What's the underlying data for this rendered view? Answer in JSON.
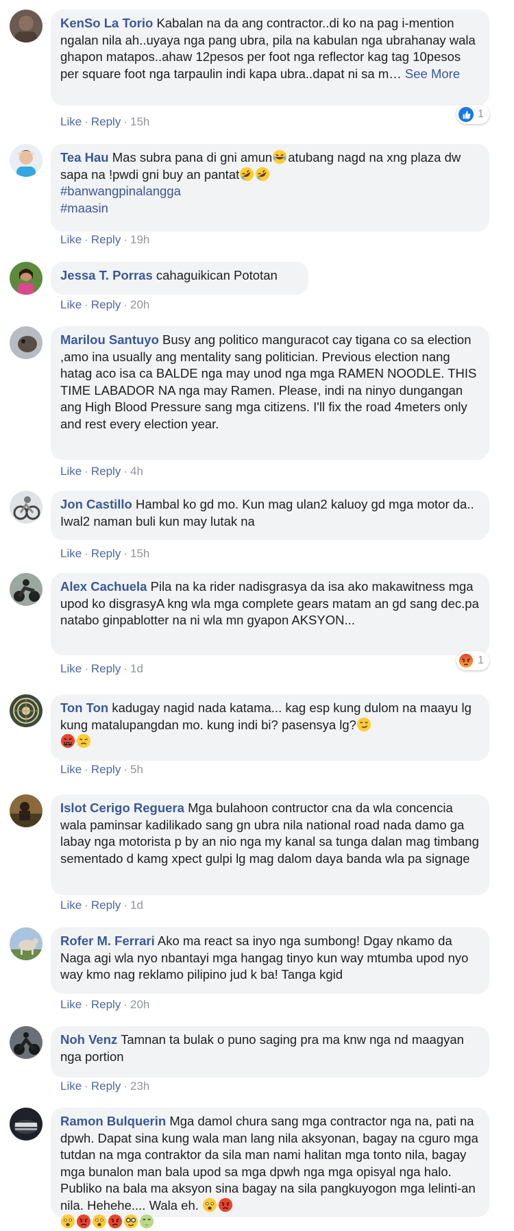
{
  "actions": {
    "like": "Like",
    "reply": "Reply",
    "sep": "·"
  },
  "see_more": "See More",
  "comments": [
    {
      "author": "KenSo La Torio",
      "text": "Kabalan na da ang contractor..di ko na pag i-mention ngalan nila ah..uyaya nga pang ubra, pila na kabulan nga ubrahanay wala ghapon matapos..ahaw 12pesos per foot nga reflector kag tag 10pesos per square foot nga tarpaulin indi kapa ubra..dapat ni sa m…",
      "time": "15h",
      "reaction": {
        "icon": "like-icon",
        "count": "1"
      }
    },
    {
      "author": "Tea Hau",
      "text": "Mas subra pana di gni amun",
      "text2": "atubang nagd na xng plaza dw sapa na !pwdi gni buy an pantat",
      "hashtags": [
        "#banwangpinalangga",
        "#maasin"
      ],
      "time": "19h"
    },
    {
      "author": "Jessa T. Porras",
      "text": "cahaguikican Pototan",
      "time": "20h"
    },
    {
      "author": "Marilou Santuyo",
      "text": "Busy ang politico manguracot cay tigana co sa election ,amo ina usually ang mentality sang politician. Previous election nang hatag aco isa ca BALDE nga may unod nga mga RAMEN NOODLE. THIS TIME LABADOR NA nga may Ramen. Please, indi na ninyo dungangan ang High Blood Pressure sang mga citizens. I'll fix the road 4meters only and rest every election year.",
      "time": "4h"
    },
    {
      "author": "Jon Castillo",
      "text": "Hambal ko gd mo. Kun mag ulan2 kaluoy gd mga motor da.. Iwal2 naman buli kun may lutak na",
      "time": "15h"
    },
    {
      "author": "Alex Cachuela",
      "text": "Pila na ka rider nadisgrasya da isa ako makawitness mga upod ko disgrasyA kng wla mga complete gears matam an gd sang dec.pa natabo ginpablotter na ni wla mn gyapon AKSYON...",
      "time": "1d",
      "reaction": {
        "icon": "angry-icon",
        "count": "1"
      }
    },
    {
      "author": "Ton Ton",
      "text": "kadugay nagid nada katama... kag esp kung dulom na maayu lg kung matalupangdan mo. kung indi bi? pasensya lg?",
      "time": "5h"
    },
    {
      "author": "Islot Cerigo Reguera",
      "text": "Mga bulahoon contructor cna da wla concencia wala paminsar kadilikado sang gn ubra nila national road nada damo ga labay nga motorista p by an nio nga my kanal sa tunga dalan mag timbang sementado d kamg xpect gulpi lg mag dalom daya banda wla pa signage",
      "time": "1d"
    },
    {
      "author": "Rofer M. Ferrari",
      "text": "Ako ma react sa inyo nga sumbong! Dgay nkamo da Naga agi wla nyo nbantayi mga hangag tinyo kun way mtumba upod nyo way kmo nag reklamo pilipino jud k ba! Tanga kgid",
      "time": "20h"
    },
    {
      "author": "Noh Venz",
      "text": "Tamnan ta bulak o puno saging pra ma knw nga nd maagyan nga portion",
      "time": "23h"
    },
    {
      "author": "Ramon Bulquerin",
      "text": "Mga damol chura sang mga contractor nga na, pati na dpwh. Dapat sina kung wala man lang nila aksyonan, bagay na cguro mga tutdan na mga contraktor da sila man nami halitan mga tonto nila, bagay mga bunalon man bala upod sa mga dpwh nga mga opisyal nga halo. Publiko na bala ma aksyon sina bagay na sila pangkuyogon mga lelinti-an nila. Hehehe.... Wala eh."
    }
  ],
  "colors": {
    "link": "#385898",
    "bubble": "#f2f3f5",
    "meta": "#90949c",
    "like_blue": "#1877f2",
    "angry_red": "#e9710f"
  }
}
